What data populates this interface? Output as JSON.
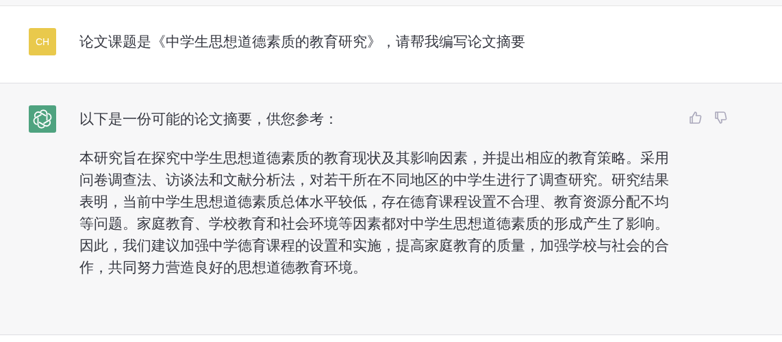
{
  "messages": [
    {
      "kind": "user",
      "avatar": "CH",
      "paragraphs": [
        "论文课题是《中学生思想道德素质的教育研究》，请帮我编写论文摘要"
      ]
    },
    {
      "kind": "assistant",
      "paragraphs": [
        "以下是一份可能的论文摘要，供您参考：",
        "本研究旨在探究中学生思想道德素质的教育现状及其影响因素，并提出相应的教育策略。采用问卷调查法、访谈法和文献分析法，对若干所在不同地区的中学生进行了调查研究。研究结果表明，当前中学生思想道德素质总体水平较低，存在德育课程设置不合理、教育资源分配不均等问题。家庭教育、学校教育和社会环境等因素都对中学生思想道德素质的形成产生了影响。因此，我们建议加强中学德育课程的设置和实施，提高家庭教育的质量，加强学校与社会的合作，共同努力营造良好的思想道德教育环境。"
      ]
    }
  ]
}
